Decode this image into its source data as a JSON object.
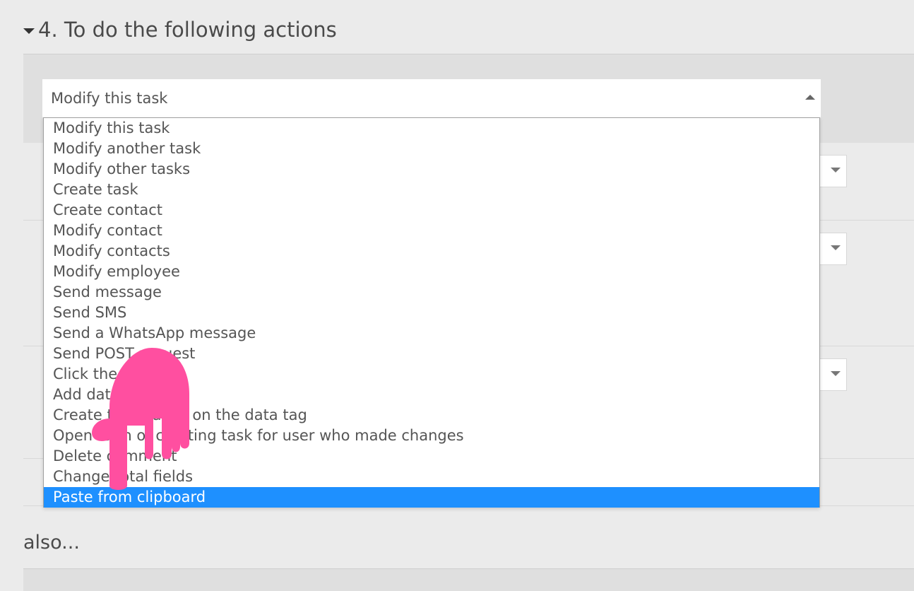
{
  "section": {
    "title": "4. To do the following actions"
  },
  "select": {
    "value": "Modify this task",
    "options": [
      "Modify this task",
      "Modify another task",
      "Modify other tasks",
      "Create task",
      "Create contact",
      "Modify contact",
      "Modify contacts",
      "Modify employee",
      "Send message",
      "Send SMS",
      "Send a WhatsApp message",
      "Send POST request",
      "Click the button",
      "Add data",
      "Create task based on the data tag",
      "Open form of creating task for user who made changes",
      "Delete comment",
      "Change total fields",
      "Paste from clipboard"
    ],
    "highlighted_option": "Paste from clipboard"
  },
  "also": {
    "label": "also..."
  },
  "colors": {
    "highlight": "#1e90ff",
    "cursor": "#ff4fa0"
  },
  "icons": {
    "collapse": "caret-down-icon",
    "open": "caret-up-icon",
    "cursor": "hand-pointer-icon"
  }
}
